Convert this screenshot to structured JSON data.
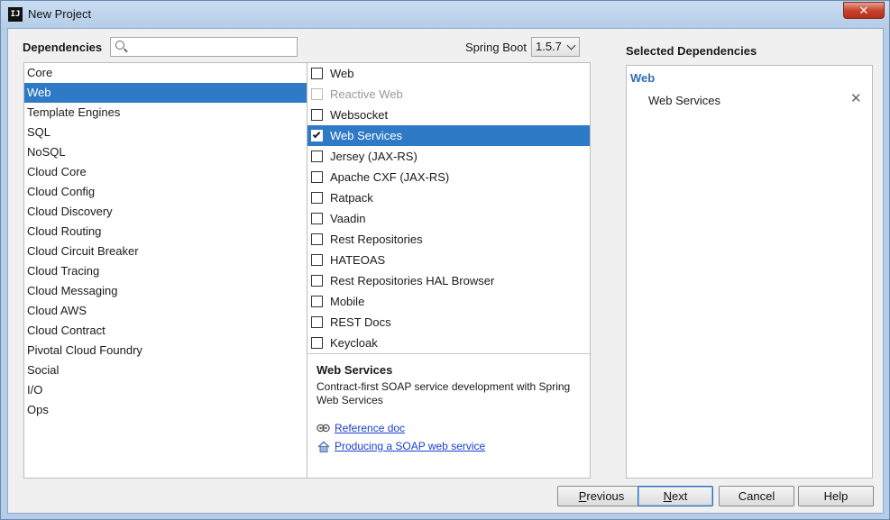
{
  "window": {
    "title": "New Project",
    "app_icon_text": "IJ",
    "close_symbol": "✕"
  },
  "header": {
    "dependencies_label": "Dependencies",
    "search": {
      "value": "",
      "placeholder": ""
    },
    "spring_boot_label": "Spring Boot",
    "spring_boot_version": "1.5.7"
  },
  "categories": {
    "selected_index": 1,
    "items": [
      "Core",
      "Web",
      "Template Engines",
      "SQL",
      "NoSQL",
      "Cloud Core",
      "Cloud Config",
      "Cloud Discovery",
      "Cloud Routing",
      "Cloud Circuit Breaker",
      "Cloud Tracing",
      "Cloud Messaging",
      "Cloud AWS",
      "Cloud Contract",
      "Pivotal Cloud Foundry",
      "Social",
      "I/O",
      "Ops"
    ]
  },
  "dependencies": {
    "items": [
      {
        "label": "Web",
        "checked": false,
        "disabled": false,
        "selected": false
      },
      {
        "label": "Reactive Web",
        "checked": false,
        "disabled": true,
        "selected": false
      },
      {
        "label": "Websocket",
        "checked": false,
        "disabled": false,
        "selected": false
      },
      {
        "label": "Web Services",
        "checked": true,
        "disabled": false,
        "selected": true
      },
      {
        "label": "Jersey (JAX-RS)",
        "checked": false,
        "disabled": false,
        "selected": false
      },
      {
        "label": "Apache CXF (JAX-RS)",
        "checked": false,
        "disabled": false,
        "selected": false
      },
      {
        "label": "Ratpack",
        "checked": false,
        "disabled": false,
        "selected": false
      },
      {
        "label": "Vaadin",
        "checked": false,
        "disabled": false,
        "selected": false
      },
      {
        "label": "Rest Repositories",
        "checked": false,
        "disabled": false,
        "selected": false
      },
      {
        "label": "HATEOAS",
        "checked": false,
        "disabled": false,
        "selected": false
      },
      {
        "label": "Rest Repositories HAL Browser",
        "checked": false,
        "disabled": false,
        "selected": false
      },
      {
        "label": "Mobile",
        "checked": false,
        "disabled": false,
        "selected": false
      },
      {
        "label": "REST Docs",
        "checked": false,
        "disabled": false,
        "selected": false
      },
      {
        "label": "Keycloak",
        "checked": false,
        "disabled": false,
        "selected": false
      }
    ]
  },
  "description": {
    "title": "Web Services",
    "text": "Contract-first SOAP service development with Spring Web Services",
    "links": [
      {
        "icon": "reference-doc-icon",
        "label": "Reference doc"
      },
      {
        "icon": "guide-home-icon",
        "label": "Producing a SOAP web service"
      }
    ]
  },
  "selected_dependencies": {
    "title": "Selected Dependencies",
    "group": "Web",
    "items": [
      {
        "label": "Web Services",
        "remove_symbol": "✕"
      }
    ]
  },
  "buttons": {
    "previous": "Previous",
    "next": "Next",
    "cancel": "Cancel",
    "help": "Help"
  },
  "colors": {
    "selection": "#2f7ac6",
    "link": "#1a3fd0",
    "group_heading": "#2f6fb5"
  }
}
